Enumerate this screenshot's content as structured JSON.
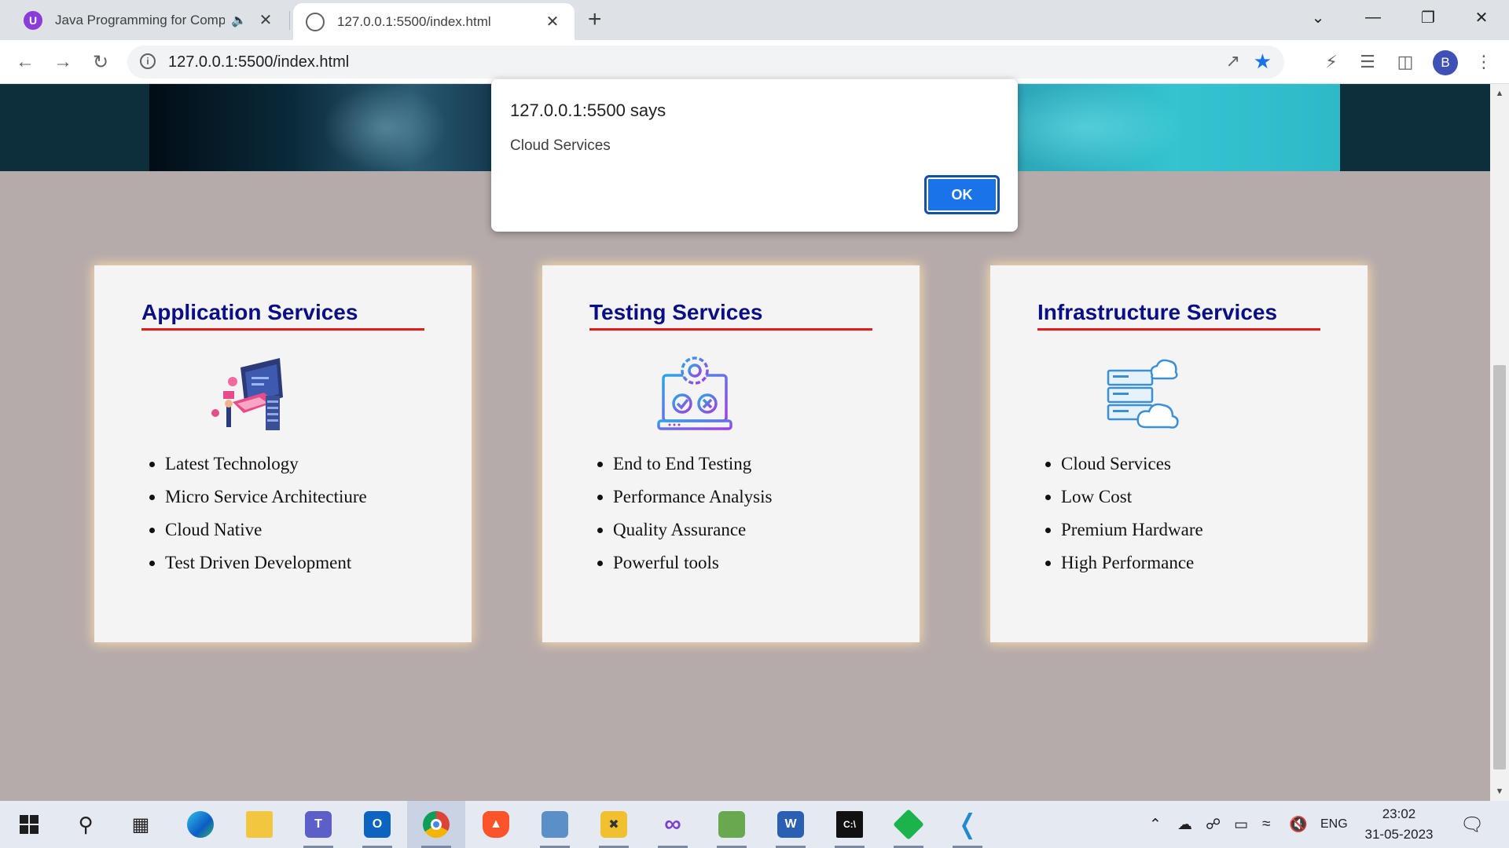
{
  "browser": {
    "tabs": [
      {
        "title": "Java Programming for Comp",
        "favicon": "purple-u-icon",
        "audio": true
      },
      {
        "title": "127.0.0.1:5500/index.html",
        "favicon": "globe-icon",
        "active": true
      }
    ],
    "url": "127.0.0.1:5500/index.html",
    "profile_initial": "B"
  },
  "dialog": {
    "title": "127.0.0.1:5500 says",
    "message": "Cloud Services",
    "ok_label": "OK"
  },
  "cards": [
    {
      "title": "Application Services",
      "icon": "developer-laptop-illustration",
      "items": [
        "Latest Technology",
        "Micro Service Architectiure",
        "Cloud Native",
        "Test Driven Development"
      ]
    },
    {
      "title": "Testing Services",
      "icon": "gear-laptop-testing-icon",
      "items": [
        "End to End Testing",
        "Performance Analysis",
        "Quality Assurance",
        "Powerful tools"
      ]
    },
    {
      "title": "Infrastructure Services",
      "icon": "server-cloud-icon",
      "items": [
        "Cloud Services",
        "Low Cost",
        "Premium Hardware",
        "High Performance"
      ]
    }
  ],
  "colors": {
    "page_background": "#b5abab",
    "card_background": "#f4f4f5",
    "heading": "#0b0f85",
    "heading_underline": "#e01c1c",
    "accent_blue": "#1a73e8"
  },
  "taskbar": {
    "language": "ENG",
    "time": "23:02",
    "date": "31-05-2023",
    "apps": [
      "windows-start-icon",
      "search-icon",
      "task-view-icon",
      "edge-icon",
      "file-explorer-icon",
      "teams-icon",
      "outlook-icon",
      "chrome-icon",
      "brave-icon",
      "archive-app-icon",
      "tools-app-icon",
      "visual-studio-icon",
      "image-app-icon",
      "word-icon",
      "terminal-icon",
      "green-app-icon",
      "vscode-icon"
    ]
  }
}
